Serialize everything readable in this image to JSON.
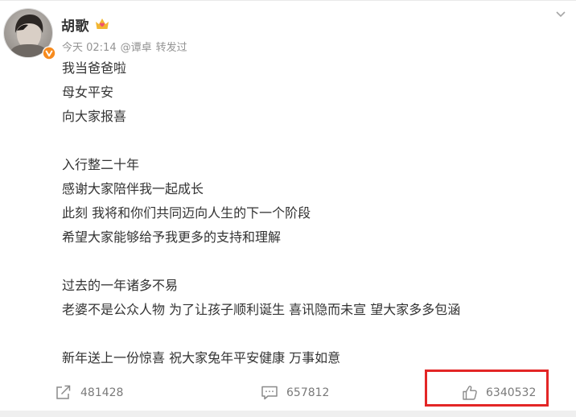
{
  "post": {
    "author": {
      "name": "胡歌"
    },
    "meta": {
      "time": "今天 02:14",
      "source": "@谭卓",
      "action": "转发过"
    },
    "lines": [
      "我当爸爸啦",
      "母女平安",
      "向大家报喜",
      "",
      "入行整二十年",
      "感谢大家陪伴我一起成长",
      "此刻 我将和你们共同迈向人生的下一个阶段",
      "希望大家能够给予我更多的支持和理解",
      "",
      "过去的一年诸多不易",
      "老婆不是公众人物 为了让孩子顺利诞生 喜讯隐而未宣 望大家多多包涵",
      "",
      "新年送上一份惊喜 祝大家兔年平安健康 万事如意"
    ]
  },
  "actions": {
    "share": {
      "icon": "share-icon",
      "count": "481428"
    },
    "comment": {
      "icon": "comment-icon",
      "count": "657812"
    },
    "like": {
      "icon": "thumbs-up-icon",
      "count": "6340532"
    }
  },
  "icons": {
    "badge": "verified-v-badge-icon",
    "vip": "vip-crown-heart-icon",
    "more": "chevron-down-icon"
  },
  "colors": {
    "text": "#333333",
    "meta": "#939393",
    "action": "#7a7a7a",
    "highlight": "#e32626",
    "verified": "#f78b1e",
    "vip": "#f2b632"
  }
}
